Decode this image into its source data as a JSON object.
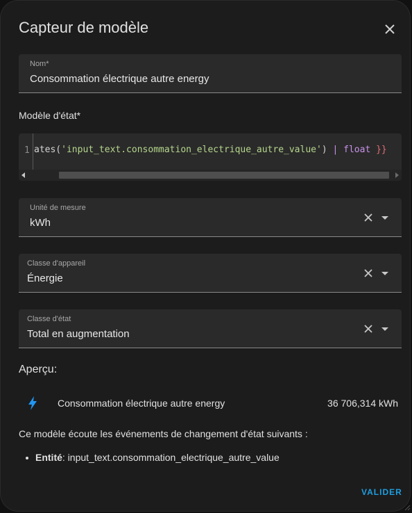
{
  "dialog": {
    "title": "Capteur de modèle",
    "close_icon": "close-icon"
  },
  "name_field": {
    "label": "Nom*",
    "value": "Consommation électrique autre energy"
  },
  "template": {
    "label": "Modèle d'état*",
    "line_number": "1",
    "code_fn": "ates(",
    "code_str": "'input_text.consommation_electrique_autre_value'",
    "code_close": ")",
    "code_pipe": " | ",
    "code_filter": "float",
    "code_brace": " }}"
  },
  "unit_field": {
    "label": "Unité de mesure",
    "value": "kWh"
  },
  "device_class_field": {
    "label": "Classe d'appareil",
    "value": "Énergie"
  },
  "state_class_field": {
    "label": "Classe d'état",
    "value": "Total en augmentation"
  },
  "preview": {
    "title": "Aperçu:",
    "icon": "lightning-bolt-icon",
    "entity_name": "Consommation électrique autre energy",
    "entity_value": "36 706,314 kWh"
  },
  "listeners": {
    "intro": "Ce modèle écoute les événements de changement d'état suivants :",
    "items": [
      {
        "key": "Entité",
        "value": ": input_text.consommation_electrique_autre_value"
      }
    ]
  },
  "actions": {
    "validate_label": "VALIDER"
  },
  "colors": {
    "accent": "#1e9fe0",
    "background": "#1c1c1c",
    "field_background": "#2a2a2a",
    "bolt_icon": "#2196f3"
  }
}
